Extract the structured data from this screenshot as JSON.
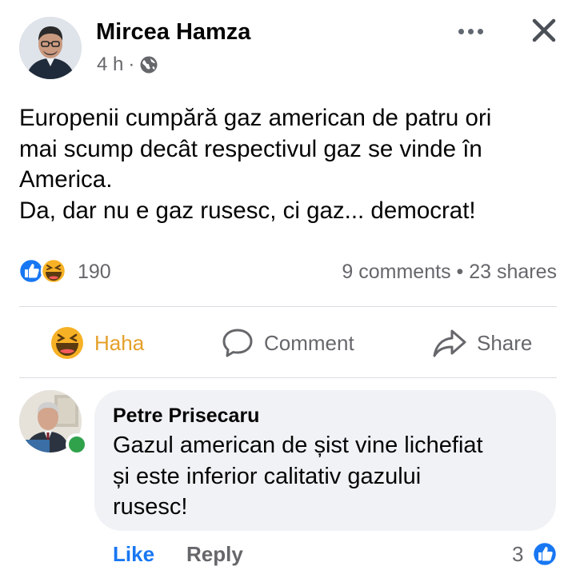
{
  "post": {
    "author": "Mircea Hamza",
    "time": "4 h",
    "separator": "·",
    "text_lines": [
      "Europenii cumpără gaz american de patru ori",
      "mai scump decât respectivul gaz se vinde în",
      "America.",
      "Da, dar nu e gaz rusesc, ci gaz... democrat!"
    ],
    "reaction_count": "190",
    "comments_shares": "9 comments • 23 shares"
  },
  "actions": {
    "haha": "Haha",
    "comment": "Comment",
    "share": "Share"
  },
  "comment": {
    "author": "Petre Prisecaru",
    "text_lines": [
      "Gazul american de șist vine lichefiat",
      "și este inferior calitativ gazului",
      "rusesc!"
    ],
    "like_label": "Like",
    "reply_label": "Reply",
    "like_count": "3"
  },
  "colors": {
    "facebook_blue": "#1877f2",
    "haha_yellow": "#f7b125",
    "secondary_text": "#65676b",
    "bubble_bg": "#f0f2f5",
    "online_green": "#31a24c"
  },
  "icons": [
    "globe-icon",
    "more-icon",
    "close-icon",
    "like-reaction-icon",
    "haha-reaction-icon",
    "comment-icon",
    "share-icon"
  ]
}
